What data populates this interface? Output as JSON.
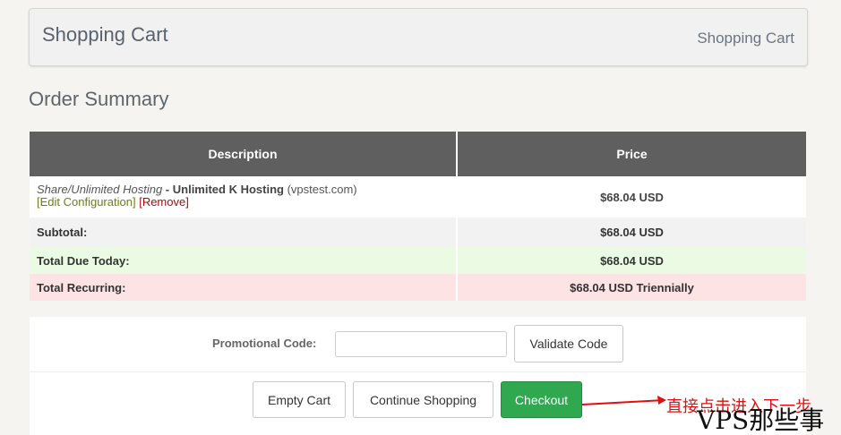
{
  "header": {
    "title": "Shopping Cart",
    "breadcrumb": "Shopping Cart"
  },
  "order_summary_title": "Order Summary",
  "table": {
    "columns": [
      "Description",
      "Price"
    ],
    "item": {
      "group": "Share/Unlimited Hosting",
      "separator": " - ",
      "product": "Unlimited K Hosting",
      "domain": "(vpstest.com)",
      "edit_link": "[Edit Configuration]",
      "remove_link": "[Remove]",
      "price": "$68.04 USD"
    },
    "subtotal": {
      "label": "Subtotal:",
      "value": "$68.04 USD"
    },
    "total_due": {
      "label": "Total Due Today:",
      "value": "$68.04 USD"
    },
    "total_recurring": {
      "label": "Total Recurring:",
      "value": "$68.04 USD Triennially"
    }
  },
  "promo": {
    "label": "Promotional Code:",
    "input_value": "",
    "validate_label": "Validate Code"
  },
  "actions": {
    "empty_cart": "Empty Cart",
    "continue_shopping": "Continue Shopping",
    "checkout": "Checkout"
  },
  "annotation": {
    "text": "直接点击进入下一步"
  },
  "watermark": "VPS那些事",
  "colors": {
    "table_header": "#5f5f5f",
    "due_row": "#ebfbe3",
    "recurring_row": "#fde3e4",
    "checkout": "#2fa84f",
    "annotation": "#e01010"
  }
}
